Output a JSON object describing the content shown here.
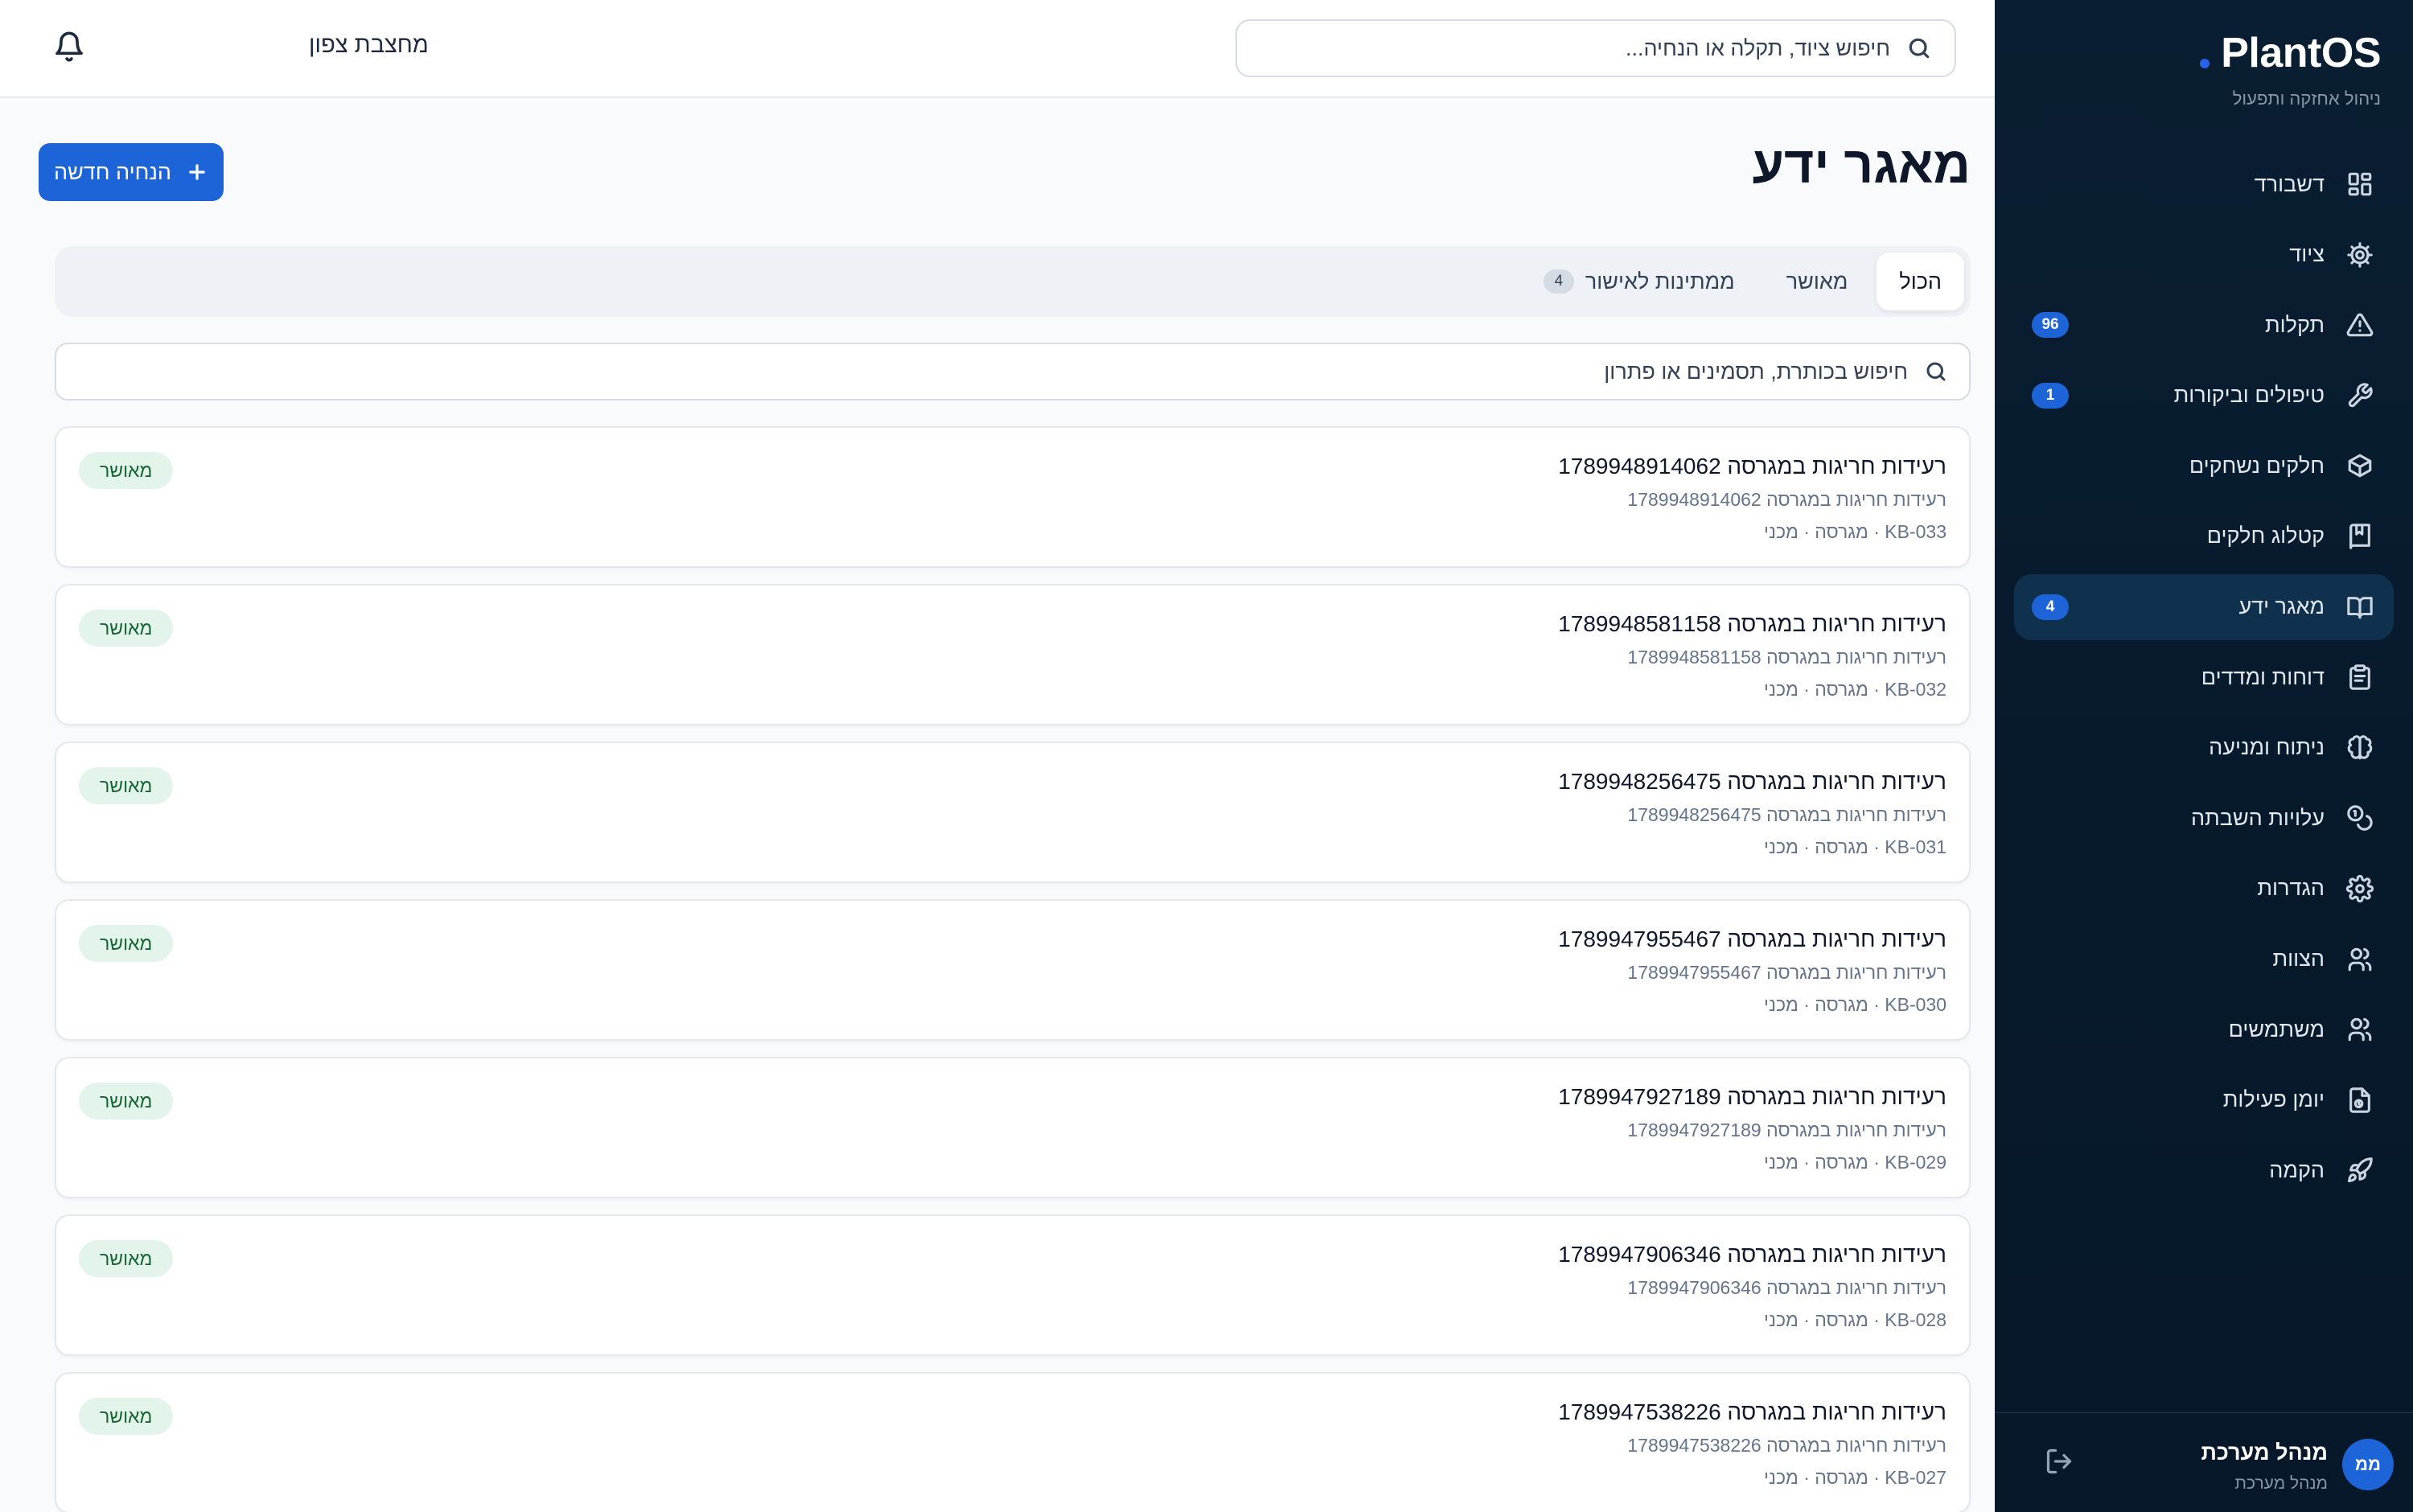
{
  "brand": {
    "name": "PlantOS",
    "subtitle": "ניהול אחזקה ותפעול",
    "accent_color": "#2563eb"
  },
  "sidebar": {
    "items": [
      {
        "label": "דשבורד",
        "icon": "grid-icon",
        "badge": null,
        "active": false
      },
      {
        "label": "ציוד",
        "icon": "gear-icon",
        "badge": null,
        "active": false
      },
      {
        "label": "תקלות",
        "icon": "warning-triangle-icon",
        "badge": "96",
        "active": false
      },
      {
        "label": "טיפולים וביקורות",
        "icon": "wrench-icon",
        "badge": "1",
        "active": false
      },
      {
        "label": "חלקים נשחקים",
        "icon": "box-icon",
        "badge": null,
        "active": false
      },
      {
        "label": "קטלוג חלקים",
        "icon": "catalog-book-icon",
        "badge": null,
        "active": false
      },
      {
        "label": "מאגר ידע",
        "icon": "open-book-icon",
        "badge": "4",
        "active": true
      },
      {
        "label": "דוחות ומדדים",
        "icon": "clipboard-icon",
        "badge": null,
        "active": false
      },
      {
        "label": "ניתוח ומניעה",
        "icon": "brain-icon",
        "badge": null,
        "active": false
      },
      {
        "label": "עלויות השבתה",
        "icon": "coins-icon",
        "badge": null,
        "active": false
      },
      {
        "label": "הגדרות",
        "icon": "settings-cog-icon",
        "badge": null,
        "active": false
      },
      {
        "label": "הצוות",
        "icon": "team-icon",
        "badge": null,
        "active": false
      },
      {
        "label": "משתמשים",
        "icon": "users-icon",
        "badge": null,
        "active": false
      },
      {
        "label": "יומן פעילות",
        "icon": "activity-log-icon",
        "badge": null,
        "active": false
      },
      {
        "label": "הקמה",
        "icon": "rocket-icon",
        "badge": null,
        "active": false
      }
    ]
  },
  "user": {
    "initials": "ממ",
    "name": "מנהל מערכת",
    "role": "מנהל מערכת"
  },
  "topbar": {
    "search_placeholder": "חיפוש ציוד, תקלה או הנחיה...",
    "site_name": "מחצבת צפון"
  },
  "main": {
    "title": "מאגר ידע",
    "new_button_label": "הנחיה חדשה",
    "tabs": [
      {
        "label": "הכול",
        "count": null,
        "active": true
      },
      {
        "label": "מאושר",
        "count": null,
        "active": false
      },
      {
        "label": "ממתינות לאישור",
        "count": "4",
        "active": false
      }
    ],
    "list_search_placeholder": "חיפוש בכותרת, תסמינים או פתרון",
    "status_color": "#e3f5ea",
    "cards": [
      {
        "title": "רעידות חריגות במגרסה 1789948914062",
        "desc": "רעידות חריגות במגרסה 1789948914062",
        "meta": "KB-033 · מגרסה · מכני",
        "status": "מאושר"
      },
      {
        "title": "רעידות חריגות במגרסה 1789948581158",
        "desc": "רעידות חריגות במגרסה 1789948581158",
        "meta": "KB-032 · מגרסה · מכני",
        "status": "מאושר"
      },
      {
        "title": "רעידות חריגות במגרסה 1789948256475",
        "desc": "רעידות חריגות במגרסה 1789948256475",
        "meta": "KB-031 · מגרסה · מכני",
        "status": "מאושר"
      },
      {
        "title": "רעידות חריגות במגרסה 1789947955467",
        "desc": "רעידות חריגות במגרסה 1789947955467",
        "meta": "KB-030 · מגרסה · מכני",
        "status": "מאושר"
      },
      {
        "title": "רעידות חריגות במגרסה 1789947927189",
        "desc": "רעידות חריגות במגרסה 1789947927189",
        "meta": "KB-029 · מגרסה · מכני",
        "status": "מאושר"
      },
      {
        "title": "רעידות חריגות במגרסה 1789947906346",
        "desc": "רעידות חריגות במגרסה 1789947906346",
        "meta": "KB-028 · מגרסה · מכני",
        "status": "מאושר"
      },
      {
        "title": "רעידות חריגות במגרסה 1789947538226",
        "desc": "רעידות חריגות במגרסה 1789947538226",
        "meta": "KB-027 · מגרסה · מכני",
        "status": "מאושר"
      }
    ]
  }
}
